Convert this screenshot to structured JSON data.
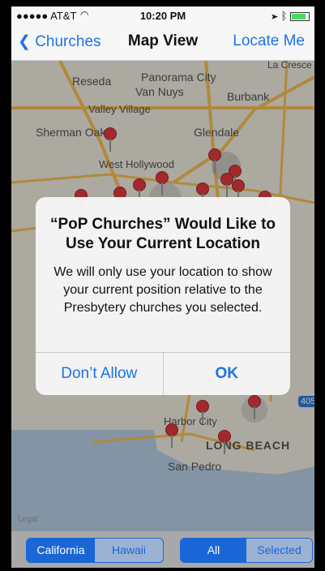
{
  "status_bar": {
    "carrier": "●●●●● AT&T",
    "wifi_icon": "wifi-icon",
    "time": "10:20 PM",
    "right_icons": [
      "location-arrow-icon",
      "bluetooth-icon",
      "battery-icon"
    ]
  },
  "nav": {
    "back_label": "Churches",
    "title": "Map View",
    "action_label": "Locate Me"
  },
  "map": {
    "labels": [
      "Reseda",
      "Panorama City",
      "Van Nuys",
      "La Cresce",
      "Burbank",
      "Valley Village",
      "Sherman Oaks",
      "Glendale",
      "West Hollywood",
      "Harbor City",
      "LONG BEACH",
      "San Pedro",
      "405"
    ],
    "legal_label": "Legal"
  },
  "alert": {
    "title": "“PoP Churches” Would Like to Use Your Current Location",
    "message": "We will only use your location to show your current position relative to the Presbytery churches you selected.",
    "deny_label": "Don’t Allow",
    "allow_label": "OK"
  },
  "bottom": {
    "region": {
      "options": [
        "California",
        "Hawaii"
      ],
      "selected": "California"
    },
    "filter": {
      "options": [
        "All",
        "Selected"
      ],
      "selected": "All"
    }
  },
  "colors": {
    "accent": "#1a73e8",
    "pin": "#d71f26",
    "alert_bg": "#f6f6f6"
  }
}
